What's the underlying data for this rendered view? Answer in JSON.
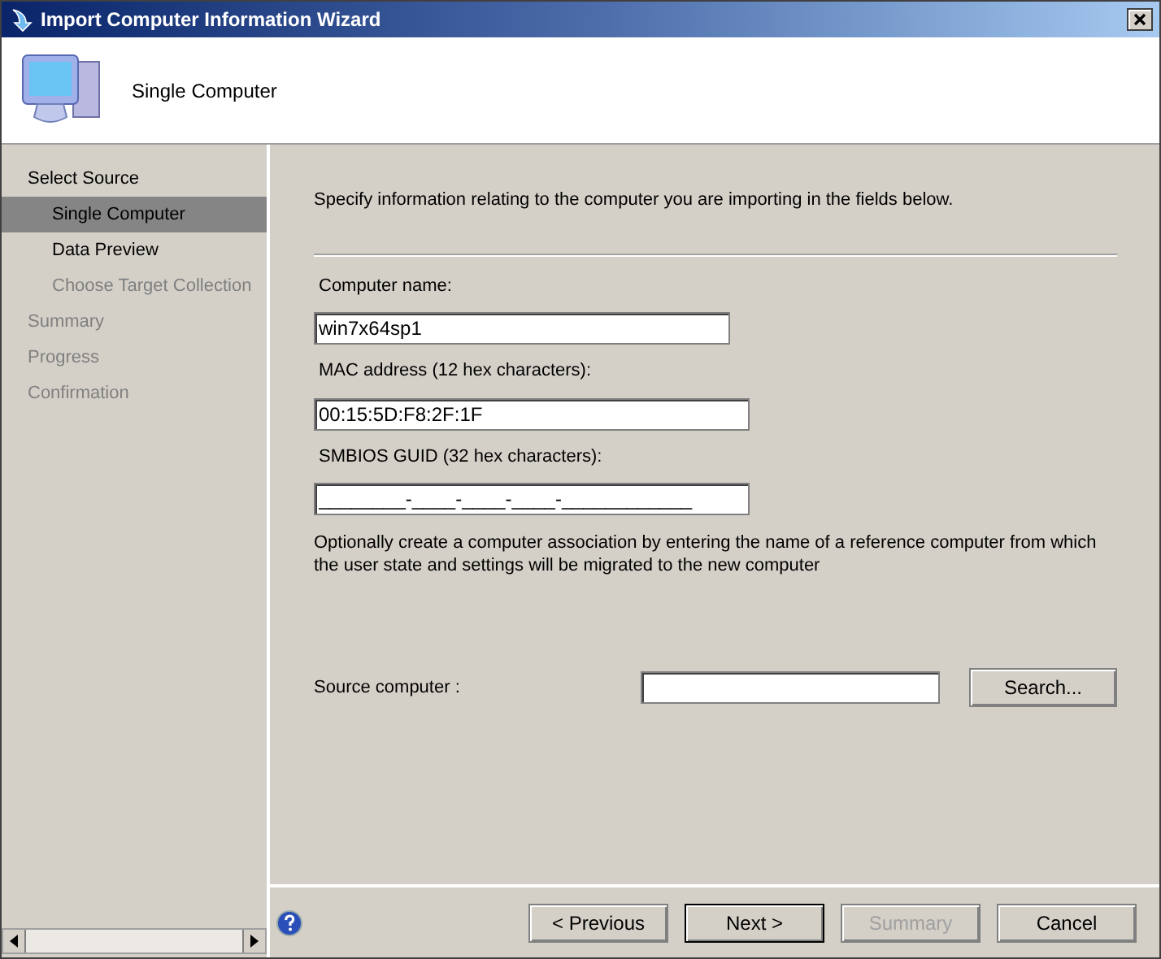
{
  "window": {
    "title": "Import Computer Information Wizard"
  },
  "header": {
    "title": "Single Computer"
  },
  "sidebar": {
    "items": [
      {
        "label": "Select Source",
        "selected": false,
        "disabled": false,
        "children": [
          {
            "label": "Single Computer",
            "selected": true,
            "disabled": false
          },
          {
            "label": "Data Preview",
            "selected": false,
            "disabled": false
          },
          {
            "label": "Choose Target Collection",
            "selected": false,
            "disabled": true
          }
        ]
      },
      {
        "label": "Summary",
        "selected": false,
        "disabled": true
      },
      {
        "label": "Progress",
        "selected": false,
        "disabled": true
      },
      {
        "label": "Confirmation",
        "selected": false,
        "disabled": true
      }
    ]
  },
  "main": {
    "intro": "Specify information relating to the computer you are importing in the fields below.",
    "fields": [
      {
        "label": "Computer name:",
        "value": "win7x64sp1",
        "wide": false
      },
      {
        "label": "MAC address (12 hex characters):",
        "value": "00:15:5D:F8:2F:1F",
        "wide": true
      },
      {
        "label": "SMBIOS GUID (32 hex characters):",
        "value": "________-____-____-____-____________",
        "wide": true
      }
    ],
    "note": "Optionally create a computer association by entering the name of a reference computer from which the user state and settings will be migrated to the new computer",
    "source_label": "Source computer :",
    "search_button": "Search..."
  },
  "buttons": [
    {
      "label": "< Previous",
      "disabled": false,
      "default": false
    },
    {
      "label": "Next >",
      "disabled": false,
      "default": true
    },
    {
      "label": "Summary",
      "disabled": true,
      "default": false
    },
    {
      "label": "Cancel",
      "disabled": false,
      "default": false
    }
  ]
}
